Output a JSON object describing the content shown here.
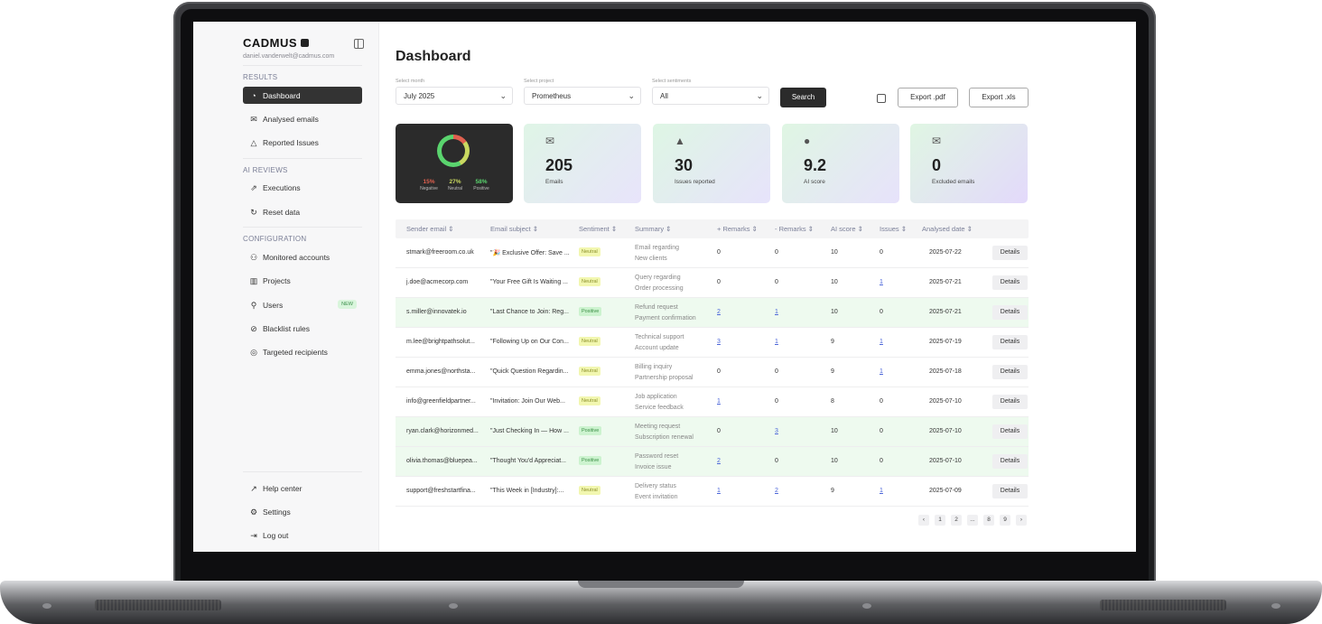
{
  "app": {
    "brand": "CADMUS",
    "user_email": "daniel.vanderwelt@cadmus.com"
  },
  "sidebar": {
    "results_label": "RESULTS",
    "results": [
      {
        "label": "Dashboard",
        "icon": "pie-chart-icon",
        "active": true
      },
      {
        "label": "Analysed emails",
        "icon": "mail-icon"
      },
      {
        "label": "Reported Issues",
        "icon": "warning-icon"
      }
    ],
    "ai_reviews_label": "AI REVIEWS",
    "ai_reviews": [
      {
        "label": "Executions",
        "icon": "external-arrow-icon"
      },
      {
        "label": "Reset data",
        "icon": "reset-icon"
      }
    ],
    "configuration_label": "CONFIGURATION",
    "configuration": [
      {
        "label": "Monitored accounts",
        "icon": "accounts-icon"
      },
      {
        "label": "Projects",
        "icon": "projects-icon"
      },
      {
        "label": "Users",
        "icon": "users-icon",
        "badge": "NEW"
      },
      {
        "label": "Blacklist rules",
        "icon": "ban-icon"
      },
      {
        "label": "Targeted recipients",
        "icon": "target-icon"
      }
    ],
    "bottom": [
      {
        "label": "Help center",
        "icon": "help-icon"
      },
      {
        "label": "Settings",
        "icon": "gear-icon"
      },
      {
        "label": "Log out",
        "icon": "logout-icon"
      }
    ]
  },
  "main": {
    "title": "Dashboard",
    "filters": {
      "month": {
        "label": "Select month",
        "value": "July 2025"
      },
      "project": {
        "label": "Select project",
        "value": "Prometheus"
      },
      "sentiment": {
        "label": "Select sentiments",
        "value": "All"
      }
    },
    "search_label": "Search",
    "export_pdf": "Export .pdf",
    "export_xls": "Export .xls"
  },
  "sentiment_card": {
    "negative": {
      "value": "15%",
      "label": "Negative",
      "color": "#e0604f"
    },
    "neutral": {
      "value": "27%",
      "label": "Neutral",
      "color": "#c9d960"
    },
    "positive": {
      "value": "58%",
      "label": "Positive",
      "color": "#5ad46e"
    }
  },
  "stat_cards": [
    {
      "value": "205",
      "label": "Emails",
      "icon": "mail-icon"
    },
    {
      "value": "30",
      "label": "Issues reported",
      "icon": "warning-icon"
    },
    {
      "value": "9.2",
      "label": "AI score",
      "icon": "ai-brain-icon"
    },
    {
      "value": "0",
      "label": "Excluded emails",
      "icon": "excluded-mail-icon"
    }
  ],
  "table": {
    "headers": [
      "Sender email",
      "Email subject",
      "Sentiment",
      "Summary",
      "+ Remarks",
      "- Remarks",
      "AI score",
      "Issues",
      "Analysed date"
    ],
    "details_label": "Details",
    "rows": [
      {
        "sender": "stmark@freeroom.co.uk",
        "subject": "\"🎉 Exclusive Offer: Save ...",
        "sentiment": "Neutral",
        "summary1": "Email regarding",
        "summary2": "New clients",
        "plus": "0",
        "minus": "0",
        "score": "10",
        "issues": "0",
        "date": "2025-07-22"
      },
      {
        "sender": "j.doe@acmecorp.com",
        "subject": "\"Your Free Gift Is Waiting ...",
        "sentiment": "Neutral",
        "summary1": "Query regarding",
        "summary2": "Order processing",
        "plus": "0",
        "minus": "0",
        "score": "10",
        "issues": "1",
        "date": "2025-07-21"
      },
      {
        "sender": "s.miller@innovatek.io",
        "subject": "\"Last Chance to Join: Reg...",
        "sentiment": "Positive",
        "summary1": "Refund request",
        "summary2": "Payment confirmation",
        "plus": "2",
        "minus": "1",
        "score": "10",
        "issues": "0",
        "date": "2025-07-21"
      },
      {
        "sender": "m.lee@brightpathsolut...",
        "subject": "\"Following Up on Our Con...",
        "sentiment": "Neutral",
        "summary1": "Technical support",
        "summary2": "Account update",
        "plus": "3",
        "minus": "1",
        "score": "9",
        "issues": "1",
        "date": "2025-07-19"
      },
      {
        "sender": "emma.jones@northsta...",
        "subject": "\"Quick Question Regardin...",
        "sentiment": "Neutral",
        "summary1": "Billing inquiry",
        "summary2": "Partnership proposal",
        "plus": "0",
        "minus": "0",
        "score": "9",
        "issues": "1",
        "date": "2025-07-18"
      },
      {
        "sender": "info@greenfieldpartner...",
        "subject": "\"Invitation: Join Our Web...",
        "sentiment": "Neutral",
        "summary1": "Job application",
        "summary2": "Service feedback",
        "plus": "1",
        "minus": "0",
        "score": "8",
        "issues": "0",
        "date": "2025-07-10"
      },
      {
        "sender": "ryan.clark@horizonmed...",
        "subject": "\"Just Checking In — How ...",
        "sentiment": "Positive",
        "summary1": "Meeting request",
        "summary2": "Subscription renewal",
        "plus": "0",
        "minus": "3",
        "score": "10",
        "issues": "0",
        "date": "2025-07-10"
      },
      {
        "sender": "olivia.thomas@bluepea...",
        "subject": "\"Thought You'd Appreciat...",
        "sentiment": "Positive",
        "summary1": "Password reset",
        "summary2": "Invoice issue",
        "plus": "2",
        "minus": "0",
        "score": "10",
        "issues": "0",
        "date": "2025-07-10"
      },
      {
        "sender": "support@freshstartfina...",
        "subject": "\"This Week in [Industry]:...",
        "sentiment": "Neutral",
        "summary1": "Delivery status",
        "summary2": "Event invitation",
        "plus": "1",
        "minus": "2",
        "score": "9",
        "issues": "1",
        "date": "2025-07-09"
      }
    ]
  },
  "pagination": [
    "‹",
    "1",
    "2",
    "...",
    "8",
    "9",
    "›"
  ]
}
